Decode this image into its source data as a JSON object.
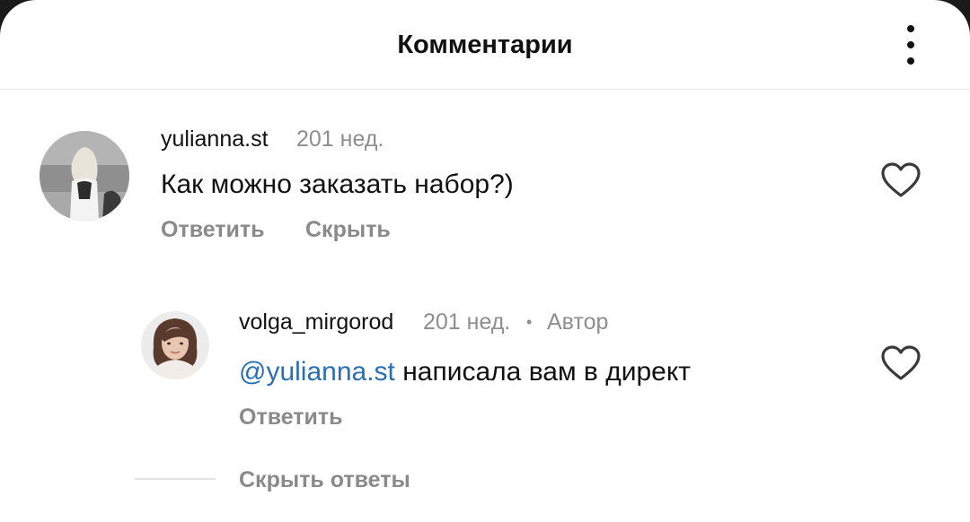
{
  "header": {
    "title": "Комментарии",
    "more_icon": "more-vertical-icon"
  },
  "comments": [
    {
      "username": "yulianna.st",
      "time": "201 нед.",
      "text": "Как можно заказать набор?)",
      "actions": {
        "reply": "Ответить",
        "hide": "Скрыть"
      },
      "like_icon": "heart-outline-icon"
    }
  ],
  "replies": [
    {
      "username": "volga_mirgorod",
      "time": "201 нед.",
      "separator": "•",
      "badge": "Автор",
      "mention": "@yulianna.st",
      "text": " написала вам в директ",
      "actions": {
        "reply": "Ответить"
      },
      "like_icon": "heart-outline-icon"
    }
  ],
  "hide_replies_label": "Скрыть ответы",
  "colors": {
    "mention": "#2a6fb4",
    "secondary_text": "#8e8e8e",
    "primary_text": "#111111"
  }
}
